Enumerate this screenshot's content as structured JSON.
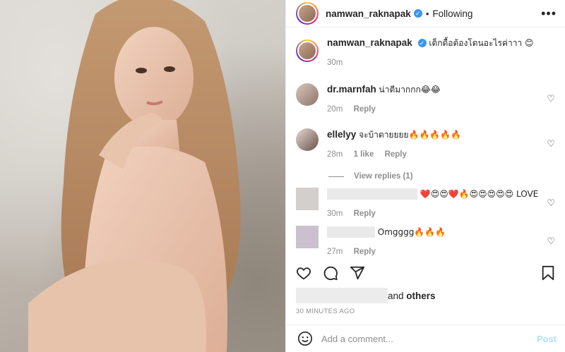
{
  "post": {
    "username": "namwan_raknapak",
    "follow_status": "Following",
    "caption": "เด็กดื้อต้องโดนอะไรค่าาา 😊",
    "caption_time": "30m"
  },
  "comments": [
    {
      "username": "dr.marnfah",
      "text": "น่าตีมากกก😂😂",
      "time": "20m",
      "likes": "",
      "reply": "Reply"
    },
    {
      "username": "ellelyy",
      "text": "จะบ้าตายยยย🔥🔥🔥🔥🔥",
      "time": "28m",
      "likes": "1 like",
      "reply": "Reply",
      "view_replies": "View replies (1)"
    },
    {
      "username": "",
      "text": "❤️😍😍❤️🔥😍😍😍😍😍 LOVE",
      "time": "30m",
      "reply": "Reply"
    },
    {
      "username": "",
      "text": "Omgggg🔥🔥🔥",
      "time": "27m",
      "reply": "Reply"
    }
  ],
  "likes_text": "and",
  "likes_others": "others",
  "time_ago": "30 MINUTES AGO",
  "comment_input": {
    "placeholder": "Add a comment...",
    "post_label": "Post"
  },
  "colors": {
    "verified": "#3897f0",
    "post_button": "#b2dffc",
    "muted": "#8e8e8e"
  },
  "icons": [
    "heart-icon",
    "comment-icon",
    "share-icon",
    "bookmark-icon",
    "smile-icon",
    "more-icon",
    "verified-badge-icon"
  ]
}
